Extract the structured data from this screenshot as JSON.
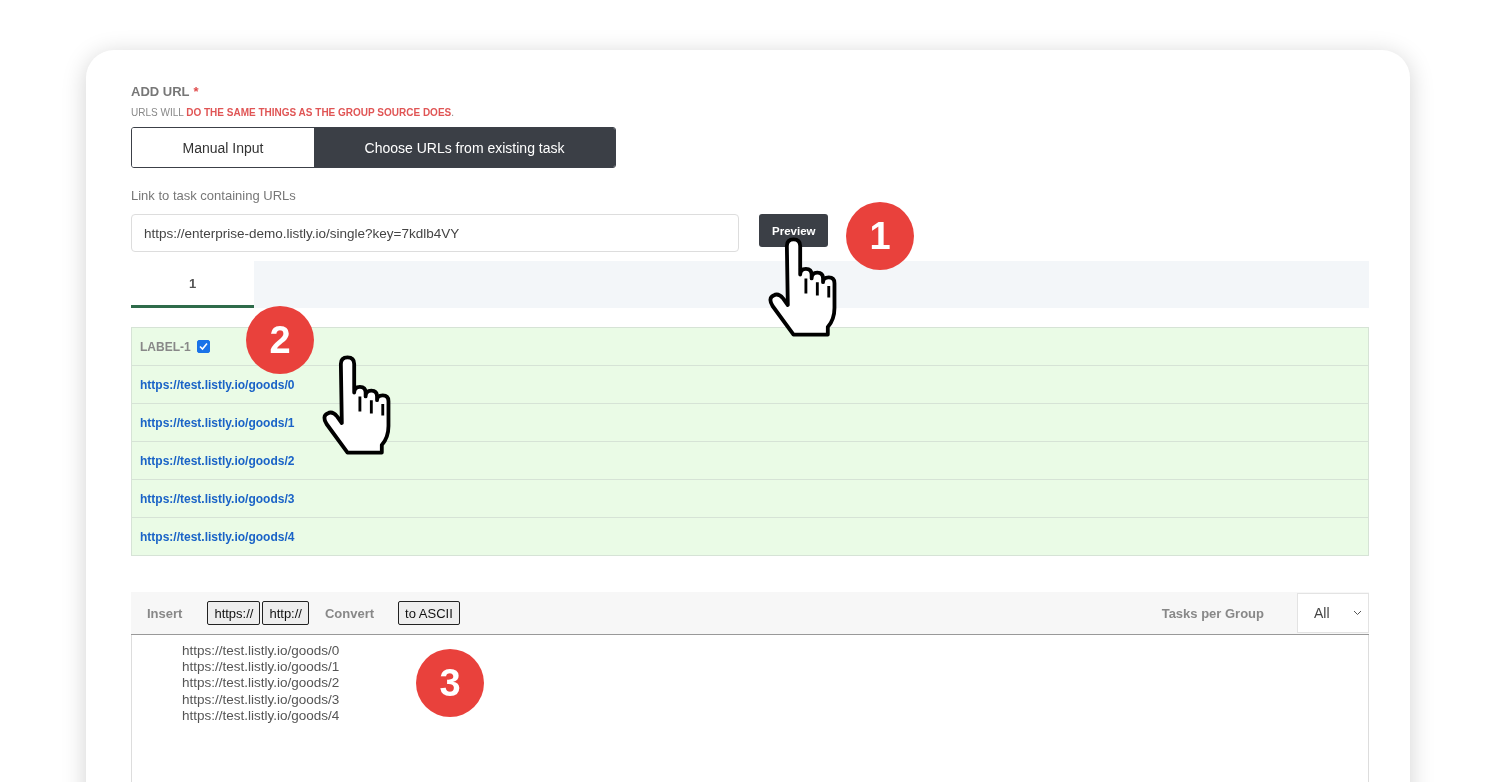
{
  "section": {
    "title": "ADD URL",
    "required_mark": "*",
    "note": "URLS WILL **DO THE SAME THINGS AS THE GROUP SOURCE DOES**."
  },
  "modes": [
    {
      "label": "Manual Input",
      "selected": false
    },
    {
      "label": "Choose URLs from existing task",
      "selected": true
    }
  ],
  "link_field": {
    "label": "Link to task containing URLs",
    "value": "https://enterprise-demo.listly.io/single?key=7kdlb4VY"
  },
  "preview_button": "Preview",
  "result_tabs": [
    {
      "label": "1",
      "selected": true
    }
  ],
  "label_row": {
    "label": "LABEL-1",
    "checked": true
  },
  "urls": [
    "https://test.listly.io/goods/0",
    "https://test.listly.io/goods/1",
    "https://test.listly.io/goods/2",
    "https://test.listly.io/goods/3",
    "https://test.listly.io/goods/4"
  ],
  "toolbar": {
    "insert_label": "Insert",
    "insert_buttons": [
      "https://",
      "http://"
    ],
    "convert_label": "Convert",
    "convert_buttons": [
      "to ASCII"
    ],
    "group_label": "Tasks per Group",
    "group_value": "All"
  },
  "url_list_text": [
    "https://test.listly.io/goods/0",
    "https://test.listly.io/goods/1",
    "https://test.listly.io/goods/2",
    "https://test.listly.io/goods/3",
    "https://test.listly.io/goods/4"
  ],
  "step_markers": [
    "1",
    "2",
    "3"
  ]
}
